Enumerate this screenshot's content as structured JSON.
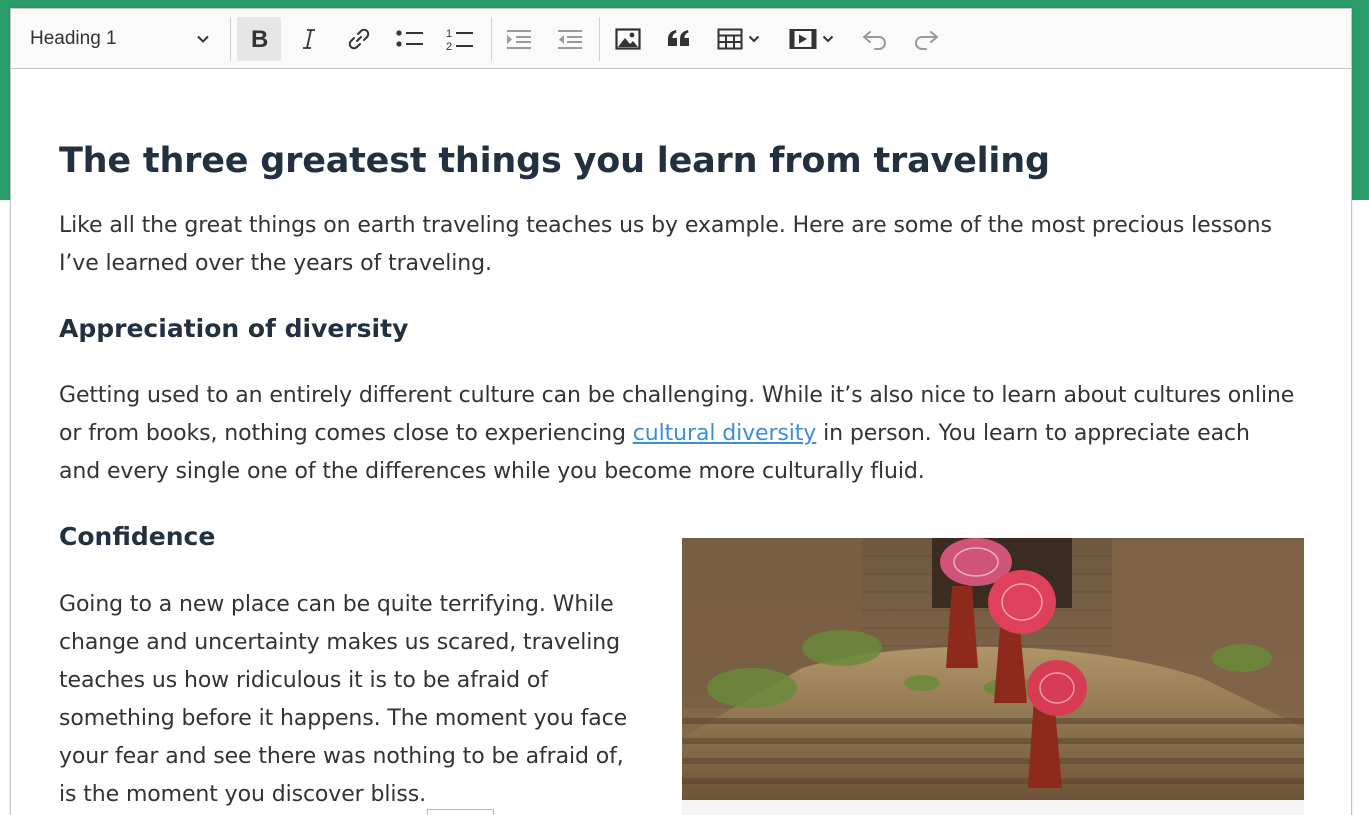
{
  "toolbar": {
    "heading_select": "Heading 1",
    "buttons": {
      "bold": "Bold",
      "italic": "Italic",
      "link": "Link",
      "bulleted_list": "Bulleted List",
      "numbered_list": "Numbered List",
      "outdent": "Decrease indent",
      "indent": "Increase indent",
      "image": "Insert image",
      "blockquote": "Block quote",
      "table": "Insert table",
      "media": "Insert media",
      "undo": "Undo",
      "redo": "Redo"
    },
    "active": "bold"
  },
  "document": {
    "title": "The three greatest things you learn from traveling",
    "intro_line1": "Like all the great things on earth traveling teaches us by example. Here are some of the most precious lessons",
    "intro_line2": "I’ve learned over the years of traveling.",
    "section1": {
      "heading": "Appreciation of diversity",
      "line1": "Getting used to an entirely different culture can be challenging. While it’s also nice to learn about cultures online",
      "line2_before": "or from books, nothing comes close to experiencing ",
      "line2_link": "cultural diversity",
      "line2_after": " in person. You learn to appreciate each",
      "line3": "and every single one of the differences while you become more culturally fluid."
    },
    "section2": {
      "heading": "Confidence",
      "lines": [
        "Going to a new place can be quite terrifying. While",
        "change and uncertainty makes us scared, traveling",
        "teaches us how ridiculous it is to be afraid of",
        "something before it happens. The moment you face",
        "your fear and see there was nothing to be afraid of,",
        "is the moment you discover bliss."
      ]
    },
    "image_subject": "monks-with-red-umbrellas-photo"
  },
  "colors": {
    "brand_green": "#2a9d6a",
    "link_blue": "#3b8fd9",
    "heading_text": "#233040",
    "body_text": "#333333",
    "toolbar_bg": "#fafafa",
    "active_button_bg": "#e6e6e6"
  }
}
